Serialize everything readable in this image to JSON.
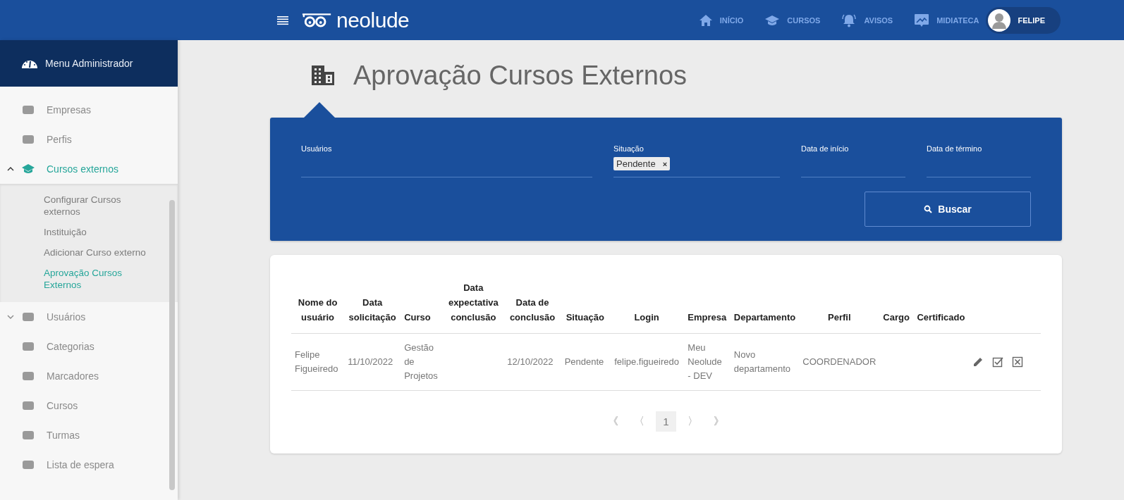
{
  "header": {
    "logo": "neolude",
    "nav": [
      {
        "label": "INÍCIO"
      },
      {
        "label": "CURSOS"
      },
      {
        "label": "AVISOS"
      },
      {
        "label": "MIDIATECA"
      }
    ],
    "user": {
      "name": "FELIPE"
    }
  },
  "sidebar": {
    "title": "Menu Administrador",
    "items": [
      {
        "label": "Empresas",
        "kind": "link"
      },
      {
        "label": "Perfis",
        "kind": "link"
      },
      {
        "label": "Cursos externos",
        "kind": "group",
        "expanded": true,
        "children": [
          {
            "label": "Configurar Cursos externos",
            "selected": false
          },
          {
            "label": "Instituição",
            "selected": false
          },
          {
            "label": "Adicionar Curso externo",
            "selected": false
          },
          {
            "label": "Aprovação Cursos Externos",
            "selected": true
          }
        ]
      },
      {
        "label": "Usuários",
        "kind": "group",
        "expanded": false
      },
      {
        "label": "Categorias",
        "kind": "link"
      },
      {
        "label": "Marcadores",
        "kind": "link"
      },
      {
        "label": "Cursos",
        "kind": "link"
      },
      {
        "label": "Turmas",
        "kind": "link"
      },
      {
        "label": "Lista de espera",
        "kind": "link"
      }
    ]
  },
  "page": {
    "title": "Aprovação Cursos Externos"
  },
  "filters": {
    "fields": [
      {
        "label": "Usuários",
        "kind": "text"
      },
      {
        "label": "Situação",
        "kind": "tags",
        "tags": [
          "Pendente"
        ],
        "tag_remove": "×"
      },
      {
        "label": "Data de início",
        "kind": "text"
      },
      {
        "label": "Data de término",
        "kind": "text"
      }
    ],
    "search_button": "Buscar"
  },
  "table": {
    "columns": [
      "Nome do usuário",
      "Data solicitação",
      "Curso",
      "Data expectativa conclusão",
      "Data de conclusão",
      "Situação",
      "Login",
      "Empresa",
      "Departamento",
      "Perfil",
      "Cargo",
      "Certificado"
    ],
    "rows": [
      {
        "cells": [
          "Felipe Figueiredo",
          "11/10/2022",
          "Gestão de Projetos",
          "",
          "12/10/2022",
          "Pendente",
          "felipe.figueiredo",
          "Meu Neolude - DEV",
          "Novo departamento",
          "COORDENADOR",
          "",
          ""
        ]
      }
    ]
  },
  "pagination": {
    "first": "《",
    "prev": "〈",
    "pages": [
      {
        "label": "1",
        "selected": true
      }
    ],
    "next": "〉",
    "last": "》"
  }
}
